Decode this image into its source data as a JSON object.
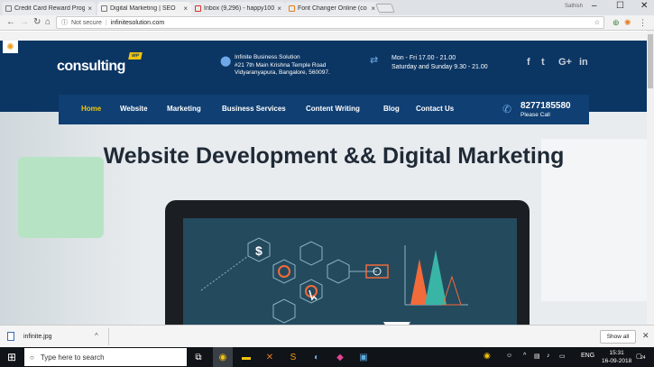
{
  "browser": {
    "tabs": [
      {
        "label": "Credit Card Reward Prog",
        "close": "×"
      },
      {
        "label": "Digital Marketing | SEO",
        "close": "×"
      },
      {
        "label": "Inbox (9,296) - happy100",
        "close": "×"
      },
      {
        "label": "Font Changer Online (co",
        "close": "×"
      }
    ],
    "user": "Sathish",
    "minimize": "–",
    "maximize": "☐",
    "close": "✕",
    "back": "←",
    "forward": "→",
    "reload": "↻",
    "home": "⌂",
    "security": "Not secure",
    "url": "infinitesolution.com",
    "star": "☆",
    "menu": "⋮"
  },
  "site": {
    "logo": "consulting",
    "logo_tag": "WP",
    "address_lines": [
      "Infinite Business Solution",
      "#21 7th Main Krishna Temple Road",
      "Vidyaranyapura, Bangalore, 560097."
    ],
    "hours_lines": [
      "Mon - Fri 17.00 - 21.00",
      "Saturday and Sunday 9.30 - 21.00"
    ],
    "social": [
      "f",
      "t",
      "G+",
      "in"
    ],
    "nav": [
      "Home",
      "Website",
      "Marketing",
      "Business Services",
      "Content Writing",
      "Blog",
      "Contact Us"
    ],
    "phone": "8277185580",
    "phone_sub": "Please Call",
    "hero_title": "Website Development && Digital Marketing"
  },
  "downloads": {
    "file": "infinite.jpg",
    "chevron": "^",
    "show_all": "Show all",
    "close": "✕"
  },
  "taskbar": {
    "search_placeholder": "Type here to search",
    "tray_lang": "ENG",
    "time": "15:31",
    "date": "16-09-2018",
    "notifications": "24"
  },
  "colors": {
    "header": "#0b3563",
    "nav_active": "#f1c40f",
    "accent_orange": "#f26b3a",
    "accent_teal": "#39b5a6"
  }
}
